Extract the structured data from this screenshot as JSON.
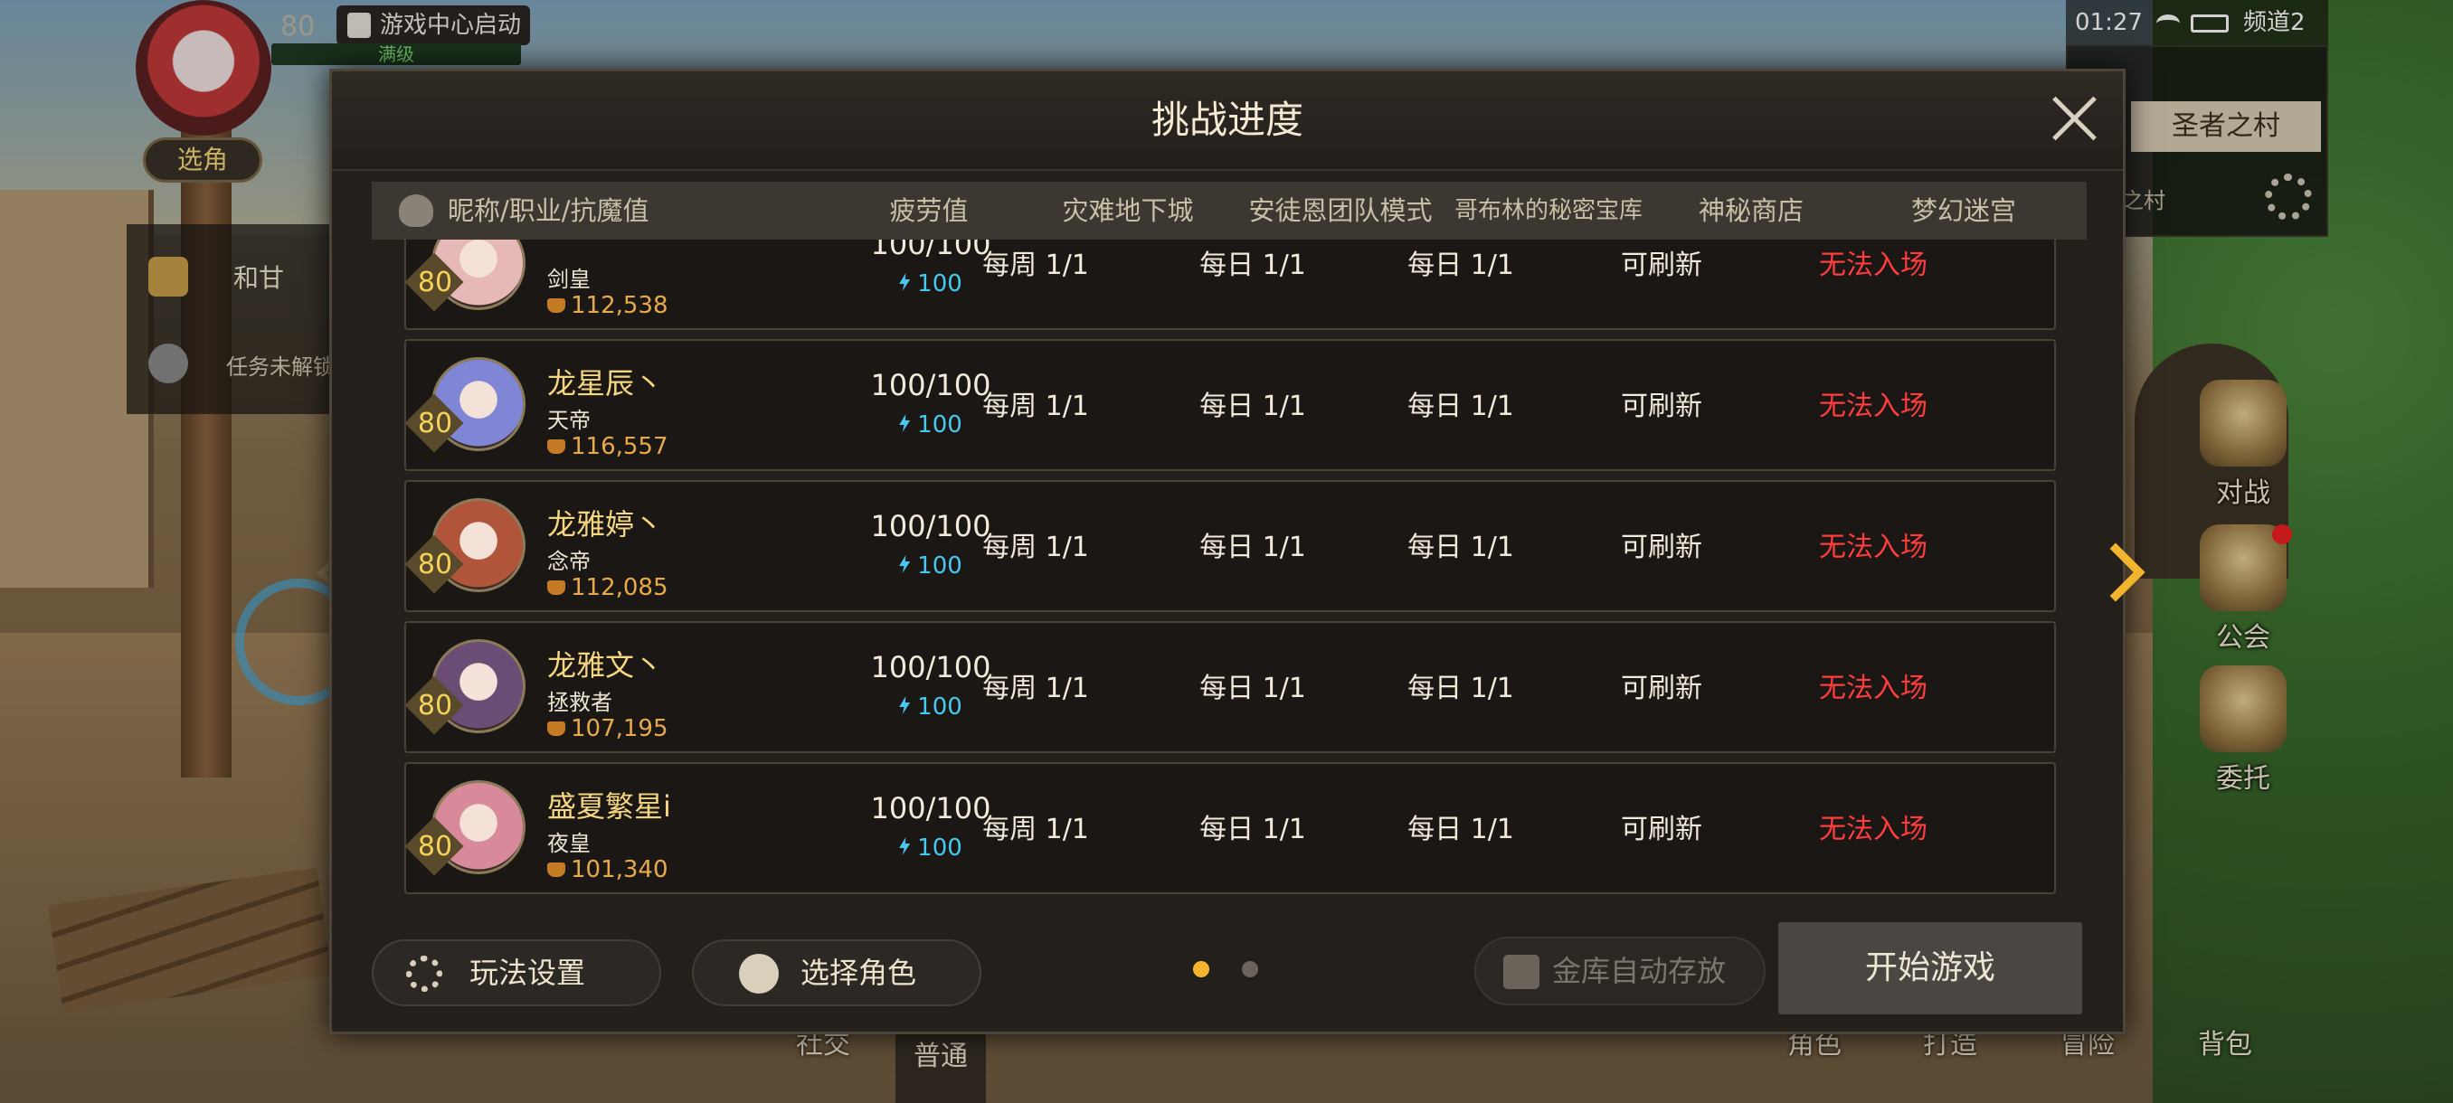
{
  "hud": {
    "level": "80",
    "game_center": "游戏中心启动",
    "max_label": "满级",
    "select_role": "选角",
    "quest_line1": "和甘",
    "quest_line2": "任务未解锁"
  },
  "status": {
    "time": "01:27",
    "channel": "频道2",
    "map_name": "圣者之村",
    "map_sub": "之村"
  },
  "side_menu": [
    {
      "label": "对战"
    },
    {
      "label": "公会"
    },
    {
      "label": "委托"
    }
  ],
  "bottom_bar": {
    "social": "社交",
    "normal": "普通",
    "role": "角色",
    "craft": "打造",
    "adventure": "冒险",
    "bag": "背包"
  },
  "dialog": {
    "title": "挑战进度",
    "columns": [
      "昵称/职业/抗魔值",
      "疲劳值",
      "灾难地下城",
      "安徒恩团队模式",
      "哥布林的秘密宝库",
      "神秘商店",
      "梦幻迷宫"
    ],
    "rows": [
      {
        "name": "",
        "job": "剑皇",
        "level": "80",
        "power": "112,538",
        "fatigue": "100/100",
        "stamina": "100",
        "disaster": "每周 1/1",
        "anton": "每日 1/1",
        "goblin": "每日 1/1",
        "shop": "可刷新",
        "maze": "无法入场"
      },
      {
        "name": "龙星辰丶",
        "job": "天帝",
        "level": "80",
        "power": "116,557",
        "fatigue": "100/100",
        "stamina": "100",
        "disaster": "每周 1/1",
        "anton": "每日 1/1",
        "goblin": "每日 1/1",
        "shop": "可刷新",
        "maze": "无法入场"
      },
      {
        "name": "龙雅婷丶",
        "job": "念帝",
        "level": "80",
        "power": "112,085",
        "fatigue": "100/100",
        "stamina": "100",
        "disaster": "每周 1/1",
        "anton": "每日 1/1",
        "goblin": "每日 1/1",
        "shop": "可刷新",
        "maze": "无法入场"
      },
      {
        "name": "龙雅文丶",
        "job": "拯救者",
        "level": "80",
        "power": "107,195",
        "fatigue": "100/100",
        "stamina": "100",
        "disaster": "每周 1/1",
        "anton": "每日 1/1",
        "goblin": "每日 1/1",
        "shop": "可刷新",
        "maze": "无法入场"
      },
      {
        "name": "盛夏繁星i",
        "job": "夜皇",
        "level": "80",
        "power": "101,340",
        "fatigue": "100/100",
        "stamina": "100",
        "disaster": "每周 1/1",
        "anton": "每日 1/1",
        "goblin": "每日 1/1",
        "shop": "可刷新",
        "maze": "无法入场"
      }
    ],
    "play_settings": "玩法设置",
    "choose_role": "选择角色",
    "vault_auto": "金库自动存放",
    "start_game": "开始游戏",
    "page_dots": {
      "count": 2,
      "active": 0
    }
  },
  "colors": {
    "gold": "#f5d681",
    "red": "#ff3d3d",
    "cyan": "#47c8f0",
    "dot_active": "#f2b52d",
    "dot_inactive": "#6a645b"
  },
  "avatar_colors": [
    "#e6b8b8",
    "#7f86d6",
    "#b0543a",
    "#6a4c74",
    "#d88a9a"
  ]
}
